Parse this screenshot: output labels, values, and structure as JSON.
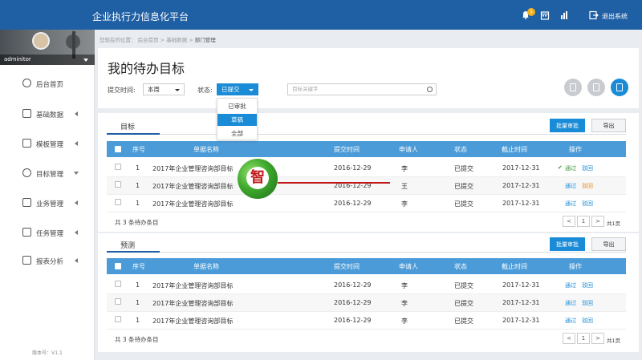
{
  "app": {
    "title": "企业执行力信息化平台",
    "notification_count": "1",
    "logout_label": "退出系统"
  },
  "sidebar": {
    "username": "adminitor",
    "items": [
      {
        "label": "后台首页",
        "icon": "home-icon",
        "arrow": ""
      },
      {
        "label": "基础数据",
        "icon": "database-icon",
        "arrow": "left"
      },
      {
        "label": "模板管理",
        "icon": "template-icon",
        "arrow": "left"
      },
      {
        "label": "目标管理",
        "icon": "target-icon",
        "arrow": "down"
      },
      {
        "label": "业务管理",
        "icon": "briefcase-icon",
        "arrow": "left"
      },
      {
        "label": "任务管理",
        "icon": "task-icon",
        "arrow": "left"
      },
      {
        "label": "报表分析",
        "icon": "chart-icon",
        "arrow": "left"
      }
    ],
    "version": "版本号：V1.1"
  },
  "breadcrumb": {
    "prefix": "您现在的位置：",
    "items": [
      "后台首页",
      "基础数据",
      "部门管理"
    ],
    "sep": ">"
  },
  "page": {
    "title": "我的待办目标"
  },
  "filters": {
    "time_label": "提交时间:",
    "time_value": "本周",
    "status_label": "状态:",
    "status_value": "已提交",
    "status_options": [
      "已审批",
      "草稿",
      "全部"
    ],
    "status_highlight_index": 1,
    "search_placeholder": "目标关键字"
  },
  "columns": [
    "序号",
    "单据名称",
    "提交时间",
    "申请人",
    "状态",
    "截止时间",
    "操作"
  ],
  "sections": [
    {
      "tab": "目标",
      "batch_label": "批量审批",
      "export_label": "导出",
      "rows": [
        {
          "no": "1",
          "name": "2017年企业管理咨询部目标",
          "time": "2016-12-29",
          "applicant": "李",
          "status": "已提交",
          "deadline": "2017-12-31",
          "ops": [
            "通过",
            "驳回"
          ],
          "op_state": "approved"
        },
        {
          "no": "1",
          "name": "2017年企业管理咨询部目标",
          "time": "2016-12-29",
          "applicant": "王",
          "status": "已提交",
          "deadline": "2017-12-31",
          "ops": [
            "通过",
            "驳回"
          ],
          "op_state": "rejected"
        },
        {
          "no": "1",
          "name": "2017年企业管理咨询部目标",
          "time": "2016-12-29",
          "applicant": "李",
          "status": "已提交",
          "deadline": "2017-12-31",
          "ops": [
            "通过",
            "驳回"
          ],
          "op_state": ""
        }
      ],
      "footer": "共 3 条待办条目",
      "page_current": "1",
      "page_total": "共1页"
    },
    {
      "tab": "预测",
      "batch_label": "批量审批",
      "export_label": "导出",
      "rows": [
        {
          "no": "1",
          "name": "2017年企业管理咨询部目标",
          "time": "2016-12-29",
          "applicant": "李",
          "status": "已提交",
          "deadline": "2017-12-31",
          "ops": [
            "通过",
            "驳回"
          ],
          "op_state": ""
        },
        {
          "no": "1",
          "name": "2017年企业管理咨询部目标",
          "time": "2016-12-29",
          "applicant": "李",
          "status": "已提交",
          "deadline": "2017-12-31",
          "ops": [
            "通过",
            "驳回"
          ],
          "op_state": ""
        },
        {
          "no": "1",
          "name": "2017年企业管理咨询部目标",
          "time": "2016-12-29",
          "applicant": "李",
          "status": "已提交",
          "deadline": "2017-12-31",
          "ops": [
            "通过",
            "驳回"
          ],
          "op_state": ""
        }
      ],
      "footer": "共 3 条待办条目",
      "page_current": "1",
      "page_total": "共1页"
    }
  ],
  "pager": {
    "prev": "<",
    "next": ">"
  },
  "watermark": {
    "char": "智"
  },
  "colors": {
    "topbar": "#1f5fa3",
    "accent": "#1a8bd6",
    "table_header": "#4a9bd8"
  }
}
